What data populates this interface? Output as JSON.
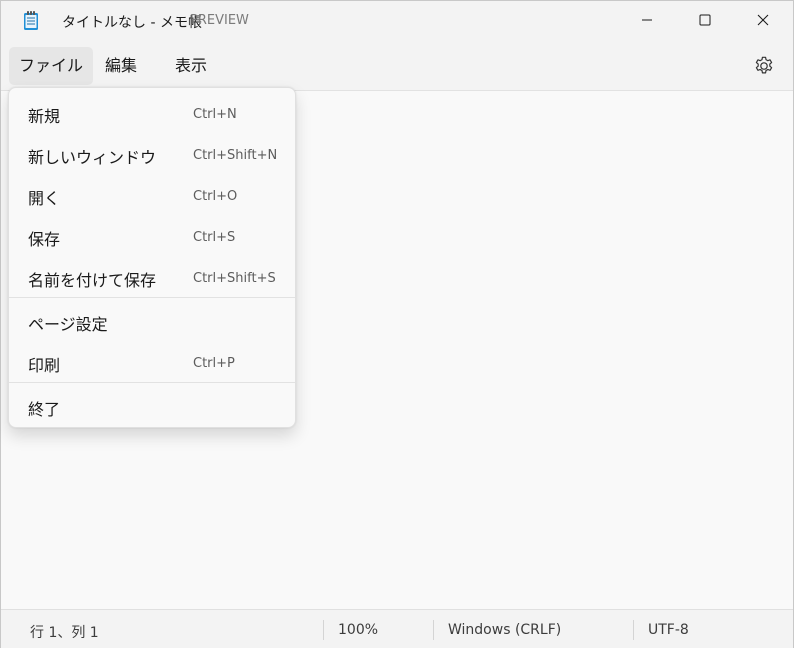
{
  "window": {
    "title": "タイトルなし - メモ帳",
    "preview_tag": "PREVIEW",
    "minimize_icon": "minimize-icon",
    "maximize_icon": "maximize-icon",
    "close_icon": "close-icon"
  },
  "menubar": {
    "items": [
      {
        "label": "ファイル"
      },
      {
        "label": "編集"
      },
      {
        "label": "表示"
      }
    ],
    "settings_icon": "gear-icon"
  },
  "file_menu": {
    "items": [
      {
        "label": "新規",
        "shortcut": "Ctrl+N"
      },
      {
        "label": "新しいウィンドウ",
        "shortcut": "Ctrl+Shift+N"
      },
      {
        "label": "開く",
        "shortcut": "Ctrl+O"
      },
      {
        "label": "保存",
        "shortcut": "Ctrl+S"
      },
      {
        "label": "名前を付けて保存",
        "shortcut": "Ctrl+Shift+S"
      },
      {
        "label": "ページ設定",
        "shortcut": ""
      },
      {
        "label": "印刷",
        "shortcut": "Ctrl+P"
      },
      {
        "label": "終了",
        "shortcut": ""
      }
    ]
  },
  "editor": {
    "content": ""
  },
  "statusbar": {
    "position": "行 1、列 1",
    "zoom": "100%",
    "line_ending": "Windows (CRLF)",
    "encoding": "UTF-8"
  },
  "colors": {
    "app_icon_accent": "#1f8fd6",
    "background": "#f3f3f3",
    "editor_background": "#f9f9f9"
  }
}
